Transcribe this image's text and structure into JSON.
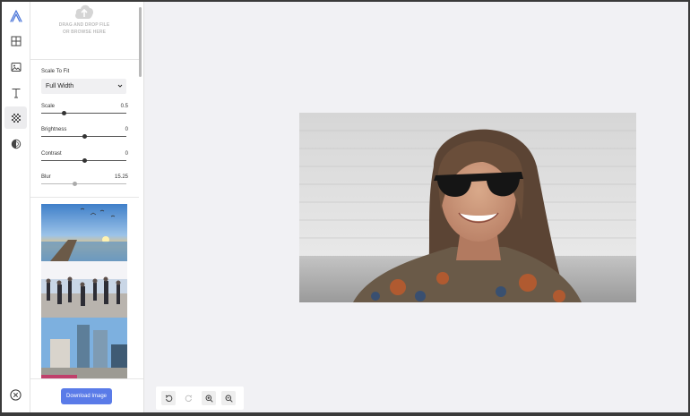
{
  "upload": {
    "line1": "DRAG AND DROP FILE",
    "line2": "OR BROWSE HERE"
  },
  "rail": {
    "items": [
      {
        "icon": "logo-icon"
      },
      {
        "icon": "grid-icon"
      },
      {
        "icon": "image-icon"
      },
      {
        "icon": "text-icon"
      },
      {
        "icon": "background-pattern-icon",
        "active": true
      },
      {
        "icon": "filter-icon"
      },
      {
        "icon": "close-icon"
      }
    ]
  },
  "settings": {
    "scale_to_fit_label": "Scale To Fit",
    "scale_to_fit_value": "Full Width",
    "sliders": [
      {
        "label": "Scale",
        "value": "0.5",
        "fraction": 0.26
      },
      {
        "label": "Brightness",
        "value": "0",
        "fraction": 0.5
      },
      {
        "label": "Contrast",
        "value": "0",
        "fraction": 0.5
      },
      {
        "label": "Blur",
        "value": "15.25",
        "fraction": 0.39
      }
    ]
  },
  "gallery": {
    "items": [
      "pier-sunset-thumbnail",
      "city-crowd-thumbnail",
      "skyscrapers-thumbnail"
    ]
  },
  "download_label": "Download Image",
  "toolbar": {
    "buttons": [
      "undo-icon",
      "redo-icon",
      "zoom-in-icon",
      "zoom-out-icon"
    ]
  },
  "colors": {
    "accent": "#5a7be8",
    "canvas_bg": "#f1f1f4",
    "logo": "#4a74d8"
  }
}
